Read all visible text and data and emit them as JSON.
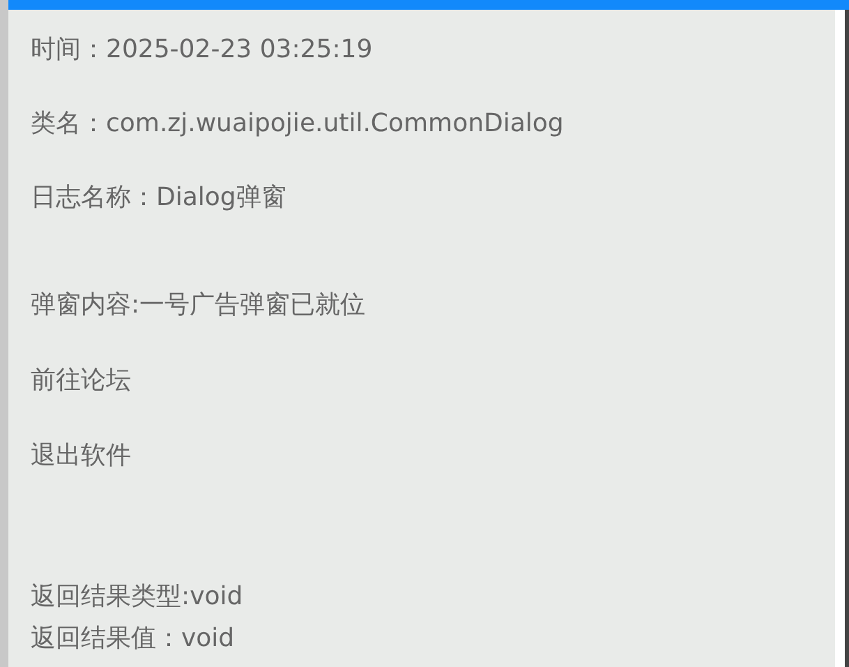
{
  "info": [
    "时间：2025-02-23 03:25:19",
    "类名：com.zj.wuaipojie.util.CommonDialog",
    "日志名称：Dialog弹窗"
  ],
  "dialog_content": [
    "弹窗内容:一号广告弹窗已就位",
    "前往论坛",
    "退出软件"
  ],
  "result": [
    "返回结果类型:void",
    "返回结果值：void"
  ]
}
